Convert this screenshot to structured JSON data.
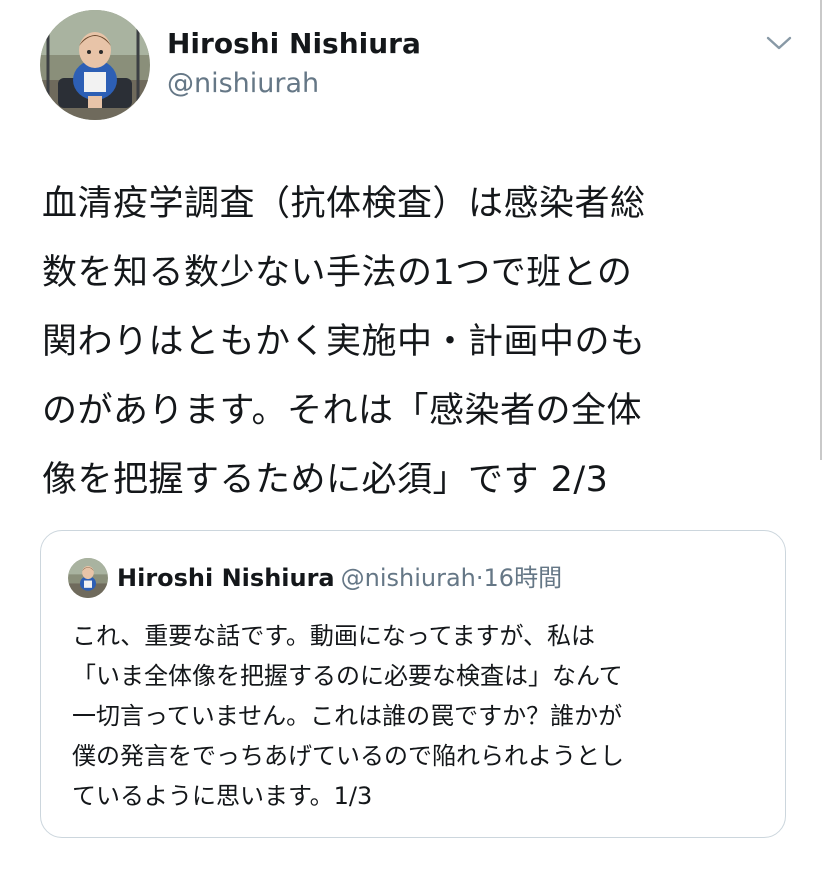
{
  "tweet": {
    "author": {
      "display_name": "Hiroshi Nishiura",
      "handle": "@nishiurah"
    },
    "menu_icon": "chevron-down-icon",
    "text_lines": [
      "血清疫学調査（抗体検査）は感染者総",
      "数を知る数少ない手法の1つで班との",
      "関わりはともかく実施中・計画中のも",
      "のがあります。それは「感染者の全体",
      "像を把握するために必須」です  2/3"
    ]
  },
  "quoted_tweet": {
    "author": {
      "display_name": "Hiroshi Nishiura",
      "handle": "@nishiurah"
    },
    "separator": "·",
    "time": "16時間",
    "text_lines": [
      "これ、重要な話です。動画になってますが、私は",
      "「いま全体像を把握するのに必要な検査は」なんて",
      "一切言っていません。これは誰の罠ですか？誰かが",
      "僕の発言をでっちあげているので陥れられようとし",
      "ているように思います。1/3"
    ]
  },
  "colors": {
    "text_primary": "#14171a",
    "text_secondary": "#657786",
    "border": "#ccd6dd"
  }
}
